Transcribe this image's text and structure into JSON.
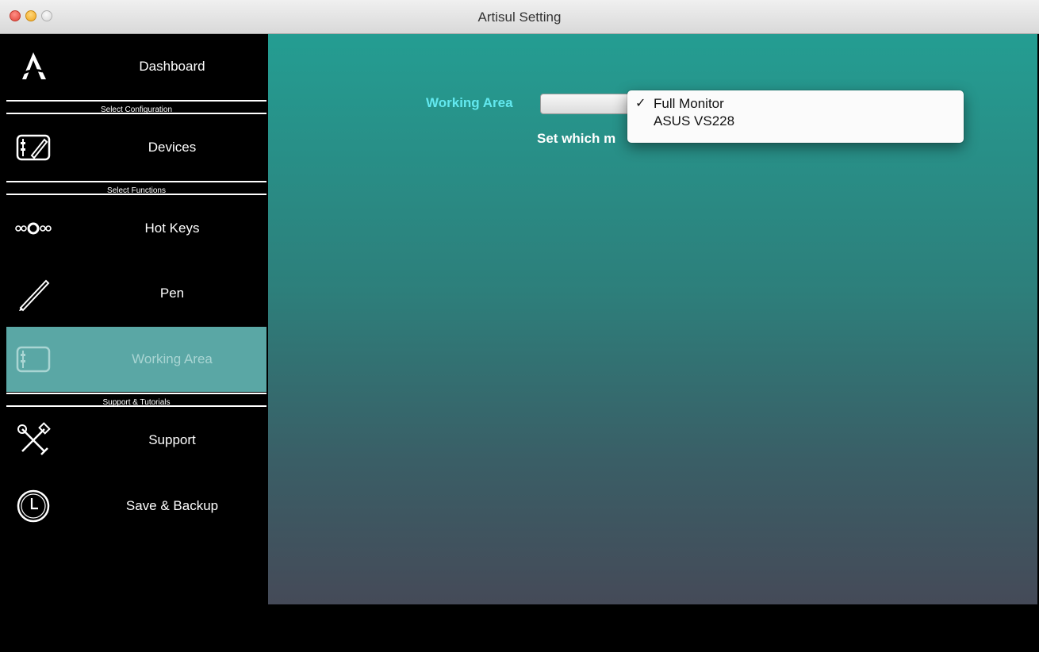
{
  "window": {
    "title": "Artisul Setting"
  },
  "sidebar": {
    "items": [
      {
        "id": "dashboard",
        "label": "Dashboard",
        "icon": "artisul-logo-icon",
        "active": false
      },
      {
        "id": "devices",
        "label": "Devices",
        "icon": "tablet-pen-icon",
        "active": false
      },
      {
        "id": "hotkeys",
        "label": "Hot Keys",
        "icon": "hotkeys-icon",
        "active": false
      },
      {
        "id": "pen",
        "label": "Pen",
        "icon": "pen-icon",
        "active": false
      },
      {
        "id": "working-area",
        "label": "Working Area",
        "icon": "tablet-icon",
        "active": true
      },
      {
        "id": "support",
        "label": "Support",
        "icon": "tools-icon",
        "active": false
      },
      {
        "id": "save-backup",
        "label": "Save & Backup",
        "icon": "clock-icon",
        "active": false
      }
    ],
    "sections": {
      "config": "Select Configuration",
      "functions": "Select Functions",
      "support": "Support & Tutorials"
    }
  },
  "main": {
    "working_area": {
      "label": "Working Area",
      "description_visible": "Set which m",
      "options": [
        {
          "label": "Full Monitor",
          "selected": true
        },
        {
          "label": "ASUS VS228",
          "selected": false
        }
      ]
    }
  },
  "colors": {
    "active_item_bg": "#5aa7a5",
    "field_label": "#62e8ef",
    "content_top": "#249d92",
    "content_bottom": "#454a58"
  }
}
